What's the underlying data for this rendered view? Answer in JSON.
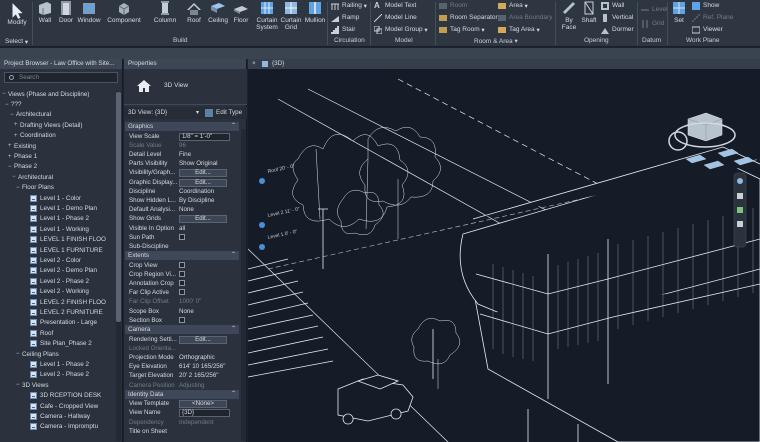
{
  "ribbon": {
    "buttons": {
      "modify": "Modify",
      "wall": "Wall",
      "door": "Door",
      "window": "Window",
      "component": "Component",
      "column": "Column",
      "roof": "Roof",
      "ceiling": "Ceiling",
      "floor": "Floor",
      "curtain_system": "Curtain System",
      "curtain_grid": "Curtain Grid",
      "mullion": "Mullion",
      "by_face": "By Face",
      "shaft": "Shaft",
      "set": "Set"
    },
    "small": {
      "railing": "Railing",
      "ramp": "Ramp",
      "stair": "Stair",
      "model_text": "Model Text",
      "model_line": "Model Line",
      "model_group": "Model Group",
      "room": "Room",
      "room_separator": "Room Separator",
      "tag_room": "Tag Room",
      "area": "Area",
      "area_boundary": "Area Boundary",
      "tag_area": "Tag Area",
      "wall": "Wall",
      "vertical": "Vertical",
      "dormer": "Dormer",
      "level": "Level",
      "grid": "Grid",
      "show": "Show",
      "ref_plane": "Ref. Plane",
      "viewer": "Viewer"
    },
    "panels": {
      "select": "Select",
      "build": "Build",
      "circulation": "Circulation",
      "model": "Model",
      "room_area": "Room & Area",
      "opening": "Opening",
      "datum": "Datum",
      "work_plane": "Work Plane"
    }
  },
  "project_browser": {
    "title": "Project Browser - Law Office with Site...",
    "search_placeholder": "Search",
    "items": [
      {
        "toggle": "−",
        "label": "Views (Phase and Discipline)",
        "icon": false
      },
      {
        "toggle": "−",
        "label": "???",
        "icon": false
      },
      {
        "toggle": "−",
        "label": "Architectural",
        "icon": false
      },
      {
        "toggle": "+",
        "label": "Drafting Views (Detail)",
        "icon": false
      },
      {
        "toggle": "+",
        "label": "Coordination",
        "icon": false
      },
      {
        "toggle": "+",
        "label": "Existing",
        "icon": false
      },
      {
        "toggle": "+",
        "label": "Phase 1",
        "icon": false
      },
      {
        "toggle": "−",
        "label": "Phase 2",
        "icon": false
      },
      {
        "toggle": "−",
        "label": "Architectural",
        "icon": false
      },
      {
        "toggle": "−",
        "label": "Floor Plans",
        "icon": false
      },
      {
        "toggle": "",
        "label": "Level 1 - Color",
        "icon": true
      },
      {
        "toggle": "",
        "label": "Level 1 - Demo Plan",
        "icon": true
      },
      {
        "toggle": "",
        "label": "Level 1 - Phase 2",
        "icon": true
      },
      {
        "toggle": "",
        "label": "Level 1 - Working",
        "icon": true
      },
      {
        "toggle": "",
        "label": "LEVEL 1 FINISH FLOO",
        "icon": true
      },
      {
        "toggle": "",
        "label": "LEVEL 1 FURNITURE",
        "icon": true
      },
      {
        "toggle": "",
        "label": "Level 2 - Color",
        "icon": true
      },
      {
        "toggle": "",
        "label": "Level 2 - Demo Plan",
        "icon": true
      },
      {
        "toggle": "",
        "label": "Level 2 - Phase 2",
        "icon": true
      },
      {
        "toggle": "",
        "label": "Level 2 - Working",
        "icon": true
      },
      {
        "toggle": "",
        "label": "LEVEL 2 FINISH FLOO",
        "icon": true
      },
      {
        "toggle": "",
        "label": "LEVEL 2 FURNITURE",
        "icon": true
      },
      {
        "toggle": "",
        "label": "Presentation - Large",
        "icon": true
      },
      {
        "toggle": "",
        "label": "Roof",
        "icon": true
      },
      {
        "toggle": "",
        "label": "Site Plan_Phase 2",
        "icon": true
      },
      {
        "toggle": "−",
        "label": "Ceiling Plans",
        "icon": false
      },
      {
        "toggle": "",
        "label": "Level 1 - Phase 2",
        "icon": true
      },
      {
        "toggle": "",
        "label": "Level 2 - Phase 2",
        "icon": true
      },
      {
        "toggle": "−",
        "label": "3D Views",
        "icon": false
      },
      {
        "toggle": "",
        "label": "3D RCEPTION DESK",
        "icon": true
      },
      {
        "toggle": "",
        "label": "Cafe - Cropped View",
        "icon": true
      },
      {
        "toggle": "",
        "label": "Camera - Hallway",
        "icon": true
      },
      {
        "toggle": "",
        "label": "Camera - Impromptu",
        "icon": true
      }
    ]
  },
  "properties": {
    "title": "Properties",
    "type_name": "3D View",
    "type_selector": "3D View: {3D}",
    "edit_type": "Edit Type",
    "sections": {
      "graphics": "Graphics",
      "extents": "Extents",
      "camera": "Camera",
      "identity": "Identity Data"
    },
    "graphics_rows": [
      {
        "k": "View Scale",
        "v": "1/8\" = 1'-0\"",
        "t": "field",
        "dis": false
      },
      {
        "k": "Scale Value",
        "v": "96",
        "t": "text",
        "dis": true
      },
      {
        "k": "Detail Level",
        "v": "Fine",
        "t": "text",
        "dis": false
      },
      {
        "k": "Parts Visibility",
        "v": "Show Original",
        "t": "text",
        "dis": false
      },
      {
        "k": "Visibility/Graph...",
        "v": "Edit...",
        "t": "btn",
        "dis": false
      },
      {
        "k": "Graphic Display...",
        "v": "Edit...",
        "t": "btn",
        "dis": false
      },
      {
        "k": "Discipline",
        "v": "Coordination",
        "t": "text",
        "dis": false
      },
      {
        "k": "Show Hidden L...",
        "v": "By Discipline",
        "t": "text",
        "dis": false
      },
      {
        "k": "Default Analysi...",
        "v": "None",
        "t": "text",
        "dis": false
      },
      {
        "k": "Show Grids",
        "v": "Edit...",
        "t": "btn",
        "dis": false
      },
      {
        "k": "Visible In Option",
        "v": "all",
        "t": "text",
        "dis": false
      },
      {
        "k": "Sun Path",
        "v": "",
        "t": "chk",
        "dis": false
      },
      {
        "k": "Sub-Discipline",
        "v": "",
        "t": "text",
        "dis": false
      }
    ],
    "extents_rows": [
      {
        "k": "Crop View",
        "v": "",
        "t": "chk",
        "dis": false
      },
      {
        "k": "Crop Region Vi...",
        "v": "",
        "t": "chk",
        "dis": false
      },
      {
        "k": "Annotation Crop",
        "v": "",
        "t": "chk",
        "dis": false
      },
      {
        "k": "Far Clip Active",
        "v": "",
        "t": "chk",
        "dis": false
      },
      {
        "k": "Far Clip Offset",
        "v": "1000' 0\"",
        "t": "text",
        "dis": true
      },
      {
        "k": "Scope Box",
        "v": "None",
        "t": "text",
        "dis": false
      },
      {
        "k": "Section Box",
        "v": "",
        "t": "chk",
        "dis": false
      }
    ],
    "camera_rows": [
      {
        "k": "Rendering Setti...",
        "v": "Edit...",
        "t": "btn",
        "dis": false
      },
      {
        "k": "Locked Orienta...",
        "v": "",
        "t": "text",
        "dis": true
      },
      {
        "k": "Projection Mode",
        "v": "Orthographic",
        "t": "text",
        "dis": false
      },
      {
        "k": "Eye Elevation",
        "v": "614' 10 165/256\"",
        "t": "text",
        "dis": false
      },
      {
        "k": "Target Elevation",
        "v": "20' 2 165/256\"",
        "t": "text",
        "dis": false
      },
      {
        "k": "Camera Position",
        "v": "Adjusting",
        "t": "text",
        "dis": true
      }
    ],
    "identity_rows": [
      {
        "k": "View Template",
        "v": "<None>",
        "t": "btn",
        "dis": false
      },
      {
        "k": "View Name",
        "v": "{3D}",
        "t": "field",
        "dis": false
      },
      {
        "k": "Dependency",
        "v": "Independent",
        "t": "text",
        "dis": true
      },
      {
        "k": "Title on Sheet",
        "v": "",
        "t": "text",
        "dis": false
      }
    ]
  },
  "view": {
    "tab_label": "{3D}",
    "level_labels": [
      "Roof 20' - 0\"",
      "Level 2 11' - 0\"",
      "Level 1 0' - 0\""
    ]
  },
  "colors": {
    "ui_bg": "#2b323d",
    "canvas_bg": "#151c27",
    "accent_blue": "#4a90d9",
    "line": "#e6ecf2"
  }
}
